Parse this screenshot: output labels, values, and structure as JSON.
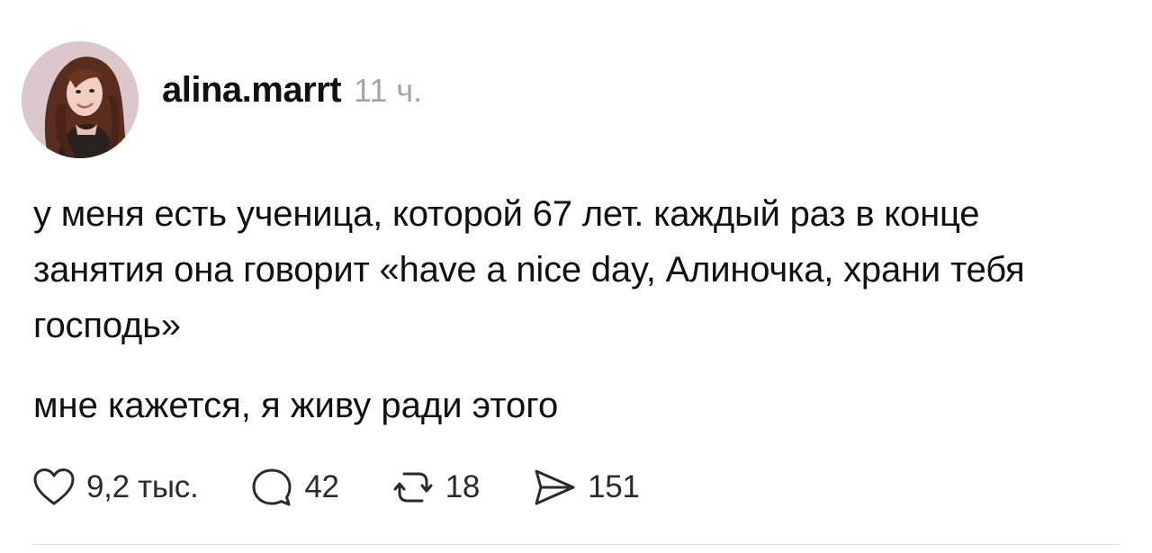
{
  "post": {
    "author": {
      "username": "alina.marrt",
      "time": "11 ч."
    },
    "text": {
      "paragraph1": "у меня есть ученица, которой 67 лет. каждый раз в конце занятия она говорит «have a nice day, Алиночка, храни тебя господь»",
      "paragraph2": "мне кажется, я живу ради этого"
    },
    "actions": {
      "likes": {
        "icon": "heart-icon",
        "count": "9,2 тыс."
      },
      "replies": {
        "icon": "comment-icon",
        "count": "42"
      },
      "reposts": {
        "icon": "repost-icon",
        "count": "18"
      },
      "shares": {
        "icon": "send-icon",
        "count": "151"
      }
    }
  },
  "colors": {
    "text": "#111111",
    "timestamp": "#a5a5a5",
    "icon": "#2b2b2b",
    "divider": "#dcdcdc"
  }
}
